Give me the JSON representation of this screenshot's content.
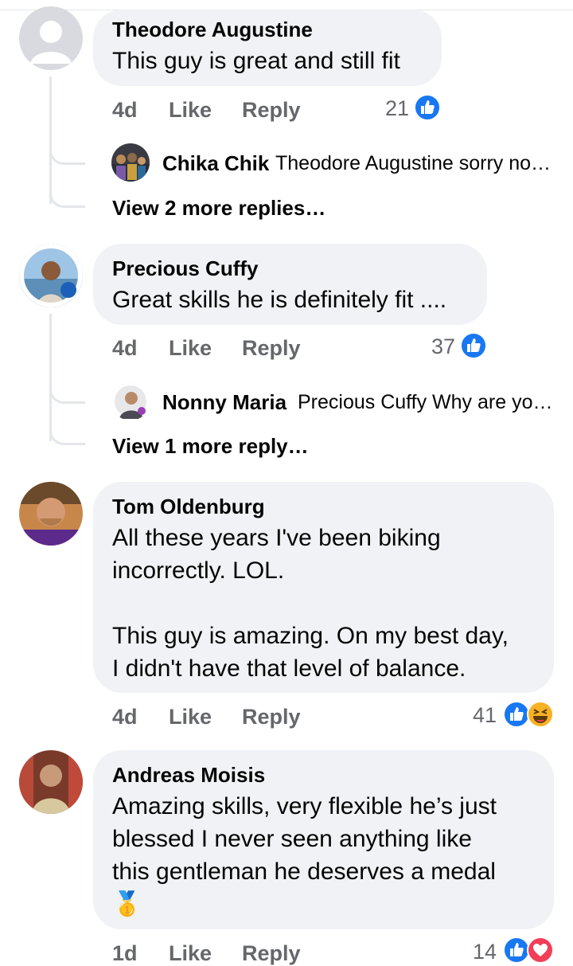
{
  "comments": [
    {
      "name": "Theodore Augustine",
      "text": "This guy is great and still fit",
      "age": "4d",
      "like_label": "Like",
      "reply_label": "Reply",
      "reaction_count": "21",
      "reactions": [
        "like"
      ],
      "replies": {
        "name": "Chika Chik",
        "preview": "Theodore Augustine sorry no…",
        "more": "View 2 more replies…"
      }
    },
    {
      "name": "Precious Cuffy",
      "text": "Great skills he is definitely fit ....",
      "age": "4d",
      "like_label": "Like",
      "reply_label": "Reply",
      "reaction_count": "37",
      "reactions": [
        "like"
      ],
      "replies": {
        "name": "Nonny Maria",
        "preview": "Precious Cuffy Why are yo…",
        "more": "View 1 more reply…"
      }
    },
    {
      "name": "Tom Oldenburg",
      "text": "All these years I've been biking\nincorrectly.  LOL.\n\nThis guy is amazing.  On my best day,\nI didn't have that level of balance.",
      "age": "4d",
      "like_label": "Like",
      "reply_label": "Reply",
      "reaction_count": "41",
      "reactions": [
        "like",
        "haha"
      ]
    },
    {
      "name": "Andreas Moisis",
      "text": "Amazing skills, very flexible he’s just\nblessed I never seen anything like\nthis gentleman he deserves a medal\n🥇",
      "age": "1d",
      "like_label": "Like",
      "reply_label": "Reply",
      "reaction_count": "14",
      "reactions": [
        "like",
        "love"
      ]
    }
  ],
  "colors": {
    "bubble": "#f0f2f5",
    "meta": "#65676b",
    "like": "#1877f2",
    "love": "#f33e58",
    "haha": "#f7b125"
  }
}
